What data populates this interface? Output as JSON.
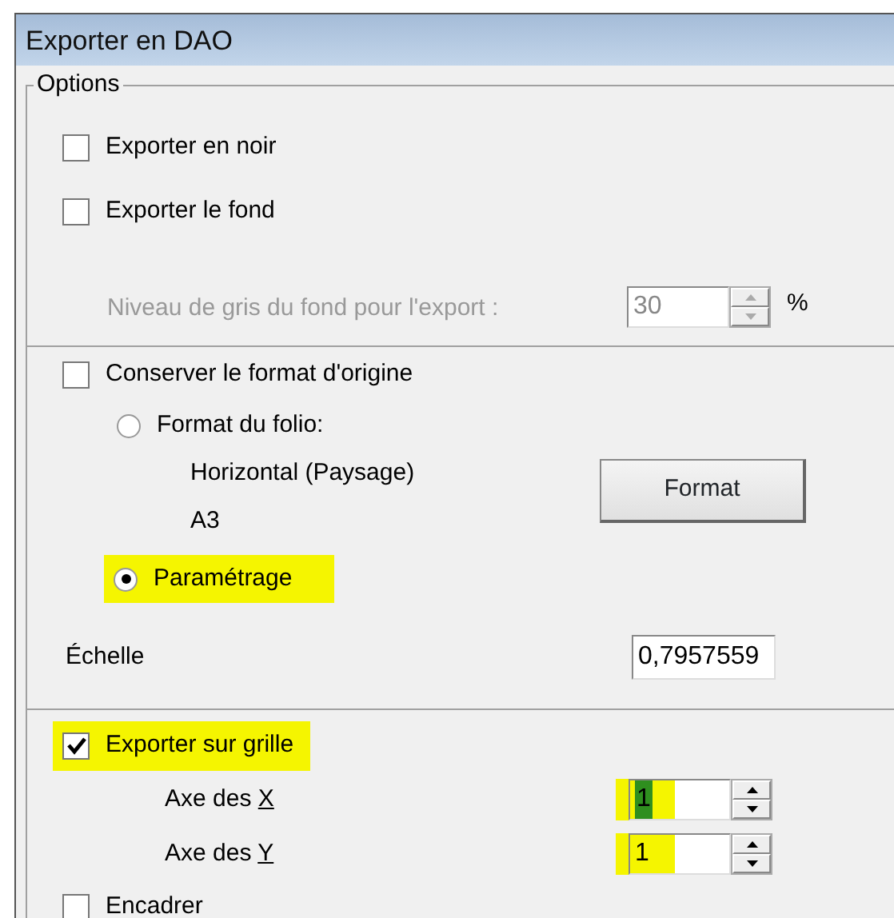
{
  "window": {
    "title": "Exporter en DAO"
  },
  "group": {
    "title": "Options"
  },
  "export_options": [
    {
      "label": "Exporter en noir",
      "checked": false
    },
    {
      "label": "Exporter le fond",
      "checked": false
    }
  ],
  "grey_level": {
    "label": "Niveau de gris du fond pour l'export :",
    "value": "30",
    "unit": "%",
    "disabled": true
  },
  "keep_format": {
    "label": "Conserver le format d'origine",
    "checked": false
  },
  "format_radios": [
    {
      "label": "Format du folio:",
      "selected": false,
      "highlighted": false
    },
    {
      "label": "Paramétrage",
      "selected": true,
      "highlighted": true
    }
  ],
  "folio_details": [
    "Horizontal (Paysage)",
    "A3"
  ],
  "format_button": "Format",
  "scale": {
    "label": "Échelle",
    "value": "0,7957559"
  },
  "grid": {
    "label": "Exporter sur grille",
    "checked": true,
    "highlighted": true
  },
  "axes": [
    {
      "label": "Axe des ",
      "mnemonic": "X",
      "value": "1",
      "highlighted": true,
      "value_selected": true
    },
    {
      "label": "Axe des ",
      "mnemonic": "Y",
      "value": "1",
      "highlighted": true,
      "value_selected": false
    }
  ],
  "frame": {
    "label": "Encadrer",
    "checked": false
  }
}
